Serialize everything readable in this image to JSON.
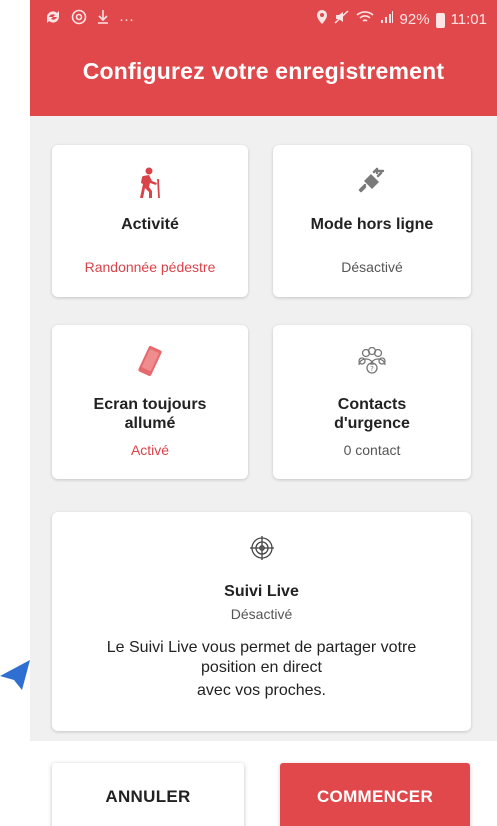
{
  "status_bar": {
    "left_icons": [
      "sync-icon",
      "at-icon",
      "download-icon",
      "more-icon"
    ],
    "battery_percent": "92%",
    "time": "11:01"
  },
  "header": {
    "title": "Configurez votre enregistrement"
  },
  "cards": {
    "activity": {
      "title": "Activité",
      "value": "Randonnée pédestre"
    },
    "offline": {
      "title": "Mode hors ligne",
      "value": "Désactivé"
    },
    "screen": {
      "title_line1": "Ecran toujours",
      "title_line2": "allumé",
      "value": "Activé"
    },
    "contacts": {
      "title_line1": "Contacts",
      "title_line2": "d'urgence",
      "value": "0 contact"
    },
    "live": {
      "title": "Suivi Live",
      "value": "Désactivé",
      "desc_line1": "Le Suivi Live vous permet de partager votre",
      "desc_line2": "position en direct",
      "desc_line3": "avec vos proches."
    }
  },
  "buttons": {
    "cancel": "ANNULER",
    "start": "COMMENCER"
  },
  "colors": {
    "accent": "#e0484c",
    "accent_text": "#d9434a",
    "background": "#f0f0f0",
    "arrow": "#2f6fd1"
  }
}
